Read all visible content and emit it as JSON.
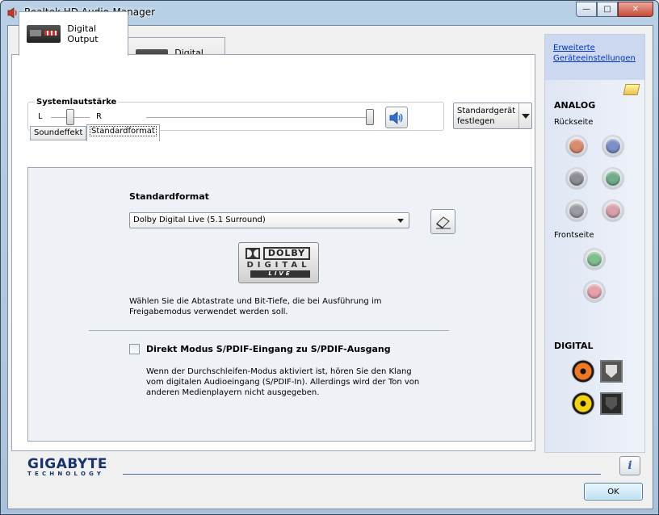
{
  "window": {
    "title": "Realtek HD Audio-Manager",
    "controls": {
      "minimize": "—",
      "maximize": "□",
      "close": "✕"
    }
  },
  "device_tabs": [
    {
      "label": "Digital Output",
      "active": true
    },
    {
      "label": "Digital Input",
      "active": false
    }
  ],
  "volume": {
    "title": "Systemlautstärke",
    "left_label": "L",
    "right_label": "R",
    "balance_position": 0.5,
    "level": 1.0,
    "speaker_icon": "speaker-icon"
  },
  "default_device_button": {
    "label": "Standardgerät festlegen"
  },
  "sub_tabs": [
    {
      "label": "Soundeffekt",
      "active": false
    },
    {
      "label": "Standardformat",
      "active": true
    }
  ],
  "standard_format": {
    "heading": "Standardformat",
    "selected": "Dolby Digital Live (5.1 Surround)",
    "dolby_logo": {
      "word": "DOLBY",
      "digital": "DIGITAL",
      "live": "LIVE"
    },
    "description": "Wählen Sie die Abtastrate und Bit-Tiefe, die bei Ausführung im Freigabemodus verwendet werden soll.",
    "checkbox_label": "Direkt Modus S/PDIF-Eingang zu S/PDIF-Ausgang",
    "checkbox_checked": false,
    "checkbox_description": "Wenn der Durchschleifen-Modus aktiviert ist, hören Sie den Klang vom digitalen Audioeingang (S/PDIF-In). Allerdings wird der Ton von anderen Medienplayern nicht ausgegeben."
  },
  "side_panel": {
    "advanced_link": "Erweiterte Geräteeinstellungen",
    "analog_heading": "ANALOG",
    "rear_label": "Rückseite",
    "front_label": "Frontseite",
    "digital_heading": "DIGITAL",
    "rear_jacks": [
      "#d98b6e",
      "#7b8fc9",
      "#8d8f93",
      "#6fae8a",
      "#9a9ca0",
      "#d8a0ab"
    ],
    "front_jacks": [
      "#7fc08e",
      "#e6a2ab"
    ],
    "digital_jacks": [
      {
        "type": "coax",
        "color": "#f07820"
      },
      {
        "type": "optical",
        "color": "#d8d8d8"
      },
      {
        "type": "coax",
        "color": "#f2d20a"
      },
      {
        "type": "optical",
        "color": "#333333"
      }
    ]
  },
  "footer": {
    "brand": "GIGABYTE",
    "brand_sub": "TECHNOLOGY",
    "info_label": "i",
    "ok_label": "OK"
  },
  "colors": {
    "accent_link": "#0033cc",
    "brand": "#17326e"
  }
}
